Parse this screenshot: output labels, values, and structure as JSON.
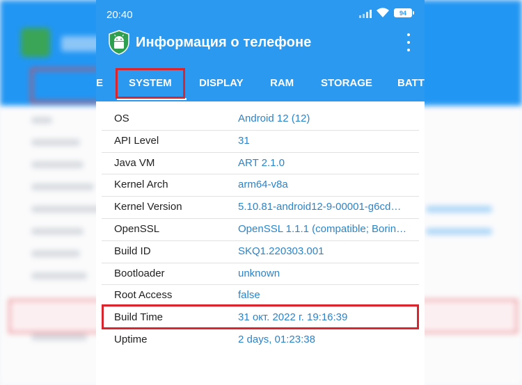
{
  "status_bar": {
    "time": "20:40",
    "battery": "94",
    "icons": [
      "signal-icon",
      "wifi-icon",
      "battery-icon"
    ]
  },
  "app_bar": {
    "title": "Информация о телефоне",
    "app_icon": "android-shield-icon",
    "menu_icon": "more-vert-icon"
  },
  "tabs": {
    "items": [
      {
        "label": "E"
      },
      {
        "label": "SYSTEM",
        "selected": true
      },
      {
        "label": "DISPLAY"
      },
      {
        "label": "RAM"
      },
      {
        "label": "STORAGE"
      },
      {
        "label": "BATT"
      }
    ]
  },
  "table": {
    "rows": [
      {
        "key": "OS",
        "value": "Android 12 (12)"
      },
      {
        "key": "API Level",
        "value": "31"
      },
      {
        "key": "Java VM",
        "value": "ART 2.1.0"
      },
      {
        "key": "Kernel Arch",
        "value": "arm64-v8a"
      },
      {
        "key": "Kernel Version",
        "value": "5.10.81-android12-9-00001-g6cd…"
      },
      {
        "key": "OpenSSL",
        "value": "OpenSSL 1.1.1 (compatible; Borin…"
      },
      {
        "key": "Build ID",
        "value": "SKQ1.220303.001"
      },
      {
        "key": "Bootloader",
        "value": "unknown"
      },
      {
        "key": "Root Access",
        "value": "false"
      },
      {
        "key": "Build Time",
        "value": "31 окт. 2022 г. 19:16:39",
        "highlighted": true
      },
      {
        "key": "Uptime",
        "value": "2 days, 01:23:38"
      }
    ]
  },
  "colors": {
    "app_bar": "#2b99f0",
    "value_text": "#2b84c8",
    "highlight_border": "#d9262e"
  }
}
